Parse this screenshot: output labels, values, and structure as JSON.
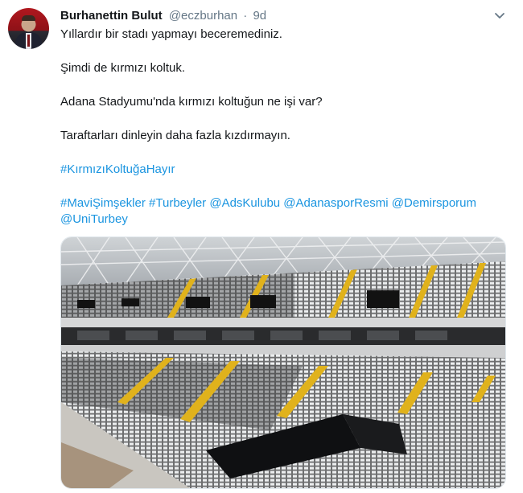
{
  "tweet": {
    "author_name": "Burhanettin Bulut",
    "author_handle": "@eczburhan",
    "separator": "·",
    "time": "9d",
    "lines": [
      "Yıllardır bir stadı yapmayı beceremediniz.",
      "Şimdi de kırmızı koltuk.",
      "Adana Stadyumu'nda kırmızı koltuğun ne işi var?",
      "Taraftarları dinleyin daha fazla kızdırmayın."
    ],
    "hashtag_main": "#KırmızıKoltuğaHayır",
    "tags": [
      "#MaviŞimşekler",
      "#Turbeyler",
      "@AdsKulubu",
      "@AdanasporResmi",
      "@Demirsporum",
      "@UniTurbey"
    ]
  },
  "icons": {
    "caret": "chevron-down-icon",
    "avatar": "profile-photo"
  },
  "colors": {
    "link": "#1b95e0",
    "meta": "#657786",
    "text": "#14171a"
  }
}
